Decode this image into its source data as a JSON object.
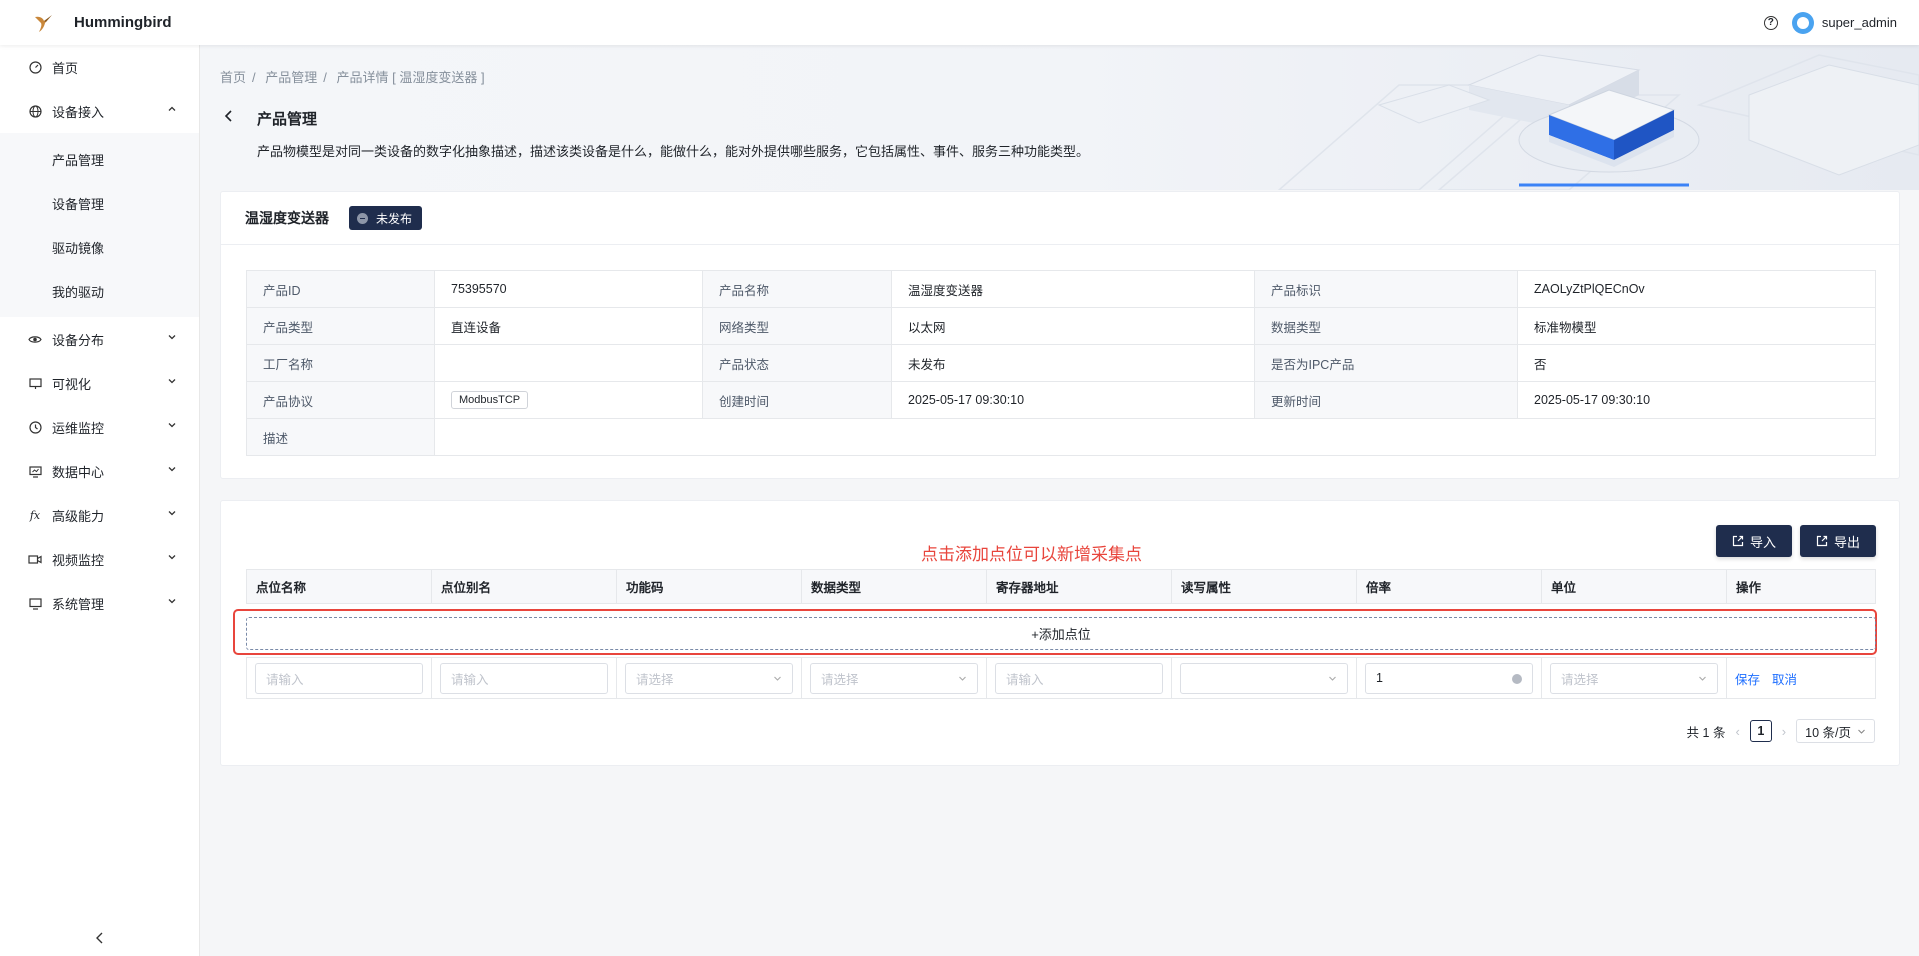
{
  "app": {
    "title": "Hummingbird",
    "username": "super_admin",
    "logo_icon": "hummingbird-logo",
    "brand_color": "#1f2d4d"
  },
  "sidebar": {
    "items": [
      {
        "label": "首页",
        "icon": "dashboard-icon"
      },
      {
        "label": "设备接入",
        "icon": "globe-icon",
        "expanded": true,
        "children": [
          "产品管理",
          "设备管理",
          "驱动镜像",
          "我的驱动"
        ]
      },
      {
        "label": "设备分布",
        "icon": "eye-icon"
      },
      {
        "label": "可视化",
        "icon": "monitor-icon"
      },
      {
        "label": "运维监控",
        "icon": "clock-icon"
      },
      {
        "label": "数据中心",
        "icon": "data-screen-icon"
      },
      {
        "label": "高级能力",
        "icon": "fx-icon"
      },
      {
        "label": "视频监控",
        "icon": "video-icon"
      },
      {
        "label": "系统管理",
        "icon": "computer-icon"
      }
    ]
  },
  "breadcrumb": [
    "首页",
    "产品管理",
    "产品详情 [ 温湿度变送器 ]"
  ],
  "page": {
    "title": "产品管理",
    "desc": "产品物模型是对同一类设备的数字化抽象描述，描述该类设备是什么，能做什么，能对外提供哪些服务，它包括属性、事件、服务三种功能类型。"
  },
  "product": {
    "name": "温湿度变送器",
    "status": "未发布",
    "info": [
      [
        "产品ID",
        "75395570",
        "产品名称",
        "温湿度变送器",
        "产品标识",
        "ZAOLyZtPlQECnOv"
      ],
      [
        "产品类型",
        "直连设备",
        "网络类型",
        "以太网",
        "数据类型",
        "标准物模型"
      ],
      [
        "工厂名称",
        "",
        "产品状态",
        "未发布",
        "是否为IPC产品",
        "否"
      ],
      [
        "产品协议",
        "ModbusTCP",
        "创建时间",
        "2025-05-17 09:30:10",
        "更新时间",
        "2025-05-17 09:30:10"
      ]
    ],
    "desc_label": "描述",
    "desc_value": ""
  },
  "points": {
    "hint": "点击添加点位可以新增采集点",
    "import_label": "导入",
    "export_label": "导出",
    "columns": [
      "点位名称",
      "点位别名",
      "功能码",
      "数据类型",
      "寄存器地址",
      "读写属性",
      "倍率",
      "单位",
      "操作"
    ],
    "add_label": "+添加点位",
    "edit_row": {
      "name_placeholder": "请输入",
      "alias_placeholder": "请输入",
      "func_placeholder": "请选择",
      "dtype_placeholder": "请选择",
      "addr_placeholder": "请输入",
      "rw_value": "",
      "rate_value": "1",
      "unit_placeholder": "请选择",
      "save_label": "保存",
      "cancel_label": "取消"
    },
    "pagination": {
      "total": "共 1 条",
      "current": "1",
      "page_size": "10 条/页"
    }
  }
}
